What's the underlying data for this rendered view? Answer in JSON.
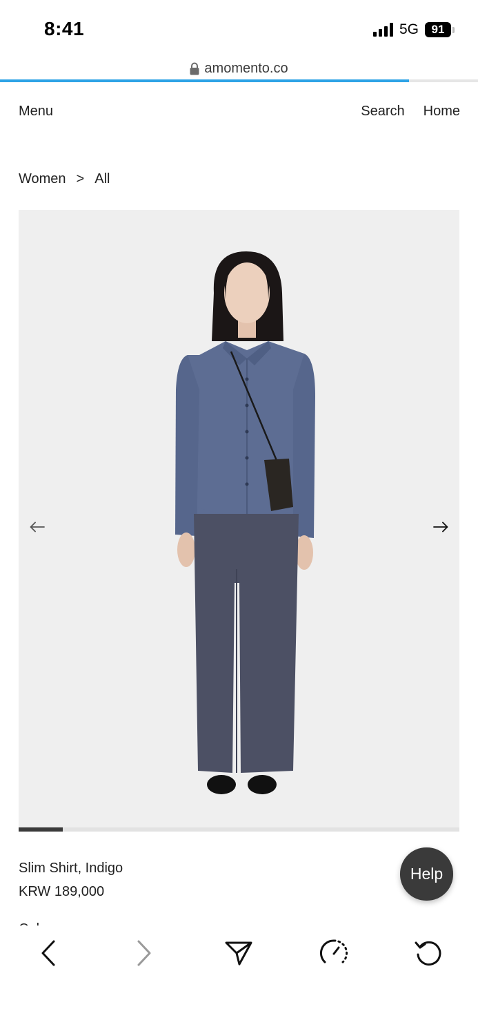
{
  "status_bar": {
    "time": "8:41",
    "network": "5G",
    "battery": "91"
  },
  "browser": {
    "url": "amomento.co",
    "load_progress": 0.856,
    "accent_color": "#2ea3e6"
  },
  "nav": {
    "menu_label": "Menu",
    "search_label": "Search",
    "home_label": "Home"
  },
  "breadcrumb": {
    "items": [
      "Women",
      ">",
      "All"
    ]
  },
  "gallery": {
    "prev_icon": "arrow-left-icon",
    "next_icon": "arrow-right-icon",
    "current_fraction": 0.1
  },
  "product": {
    "name": "Slim Shirt, Indigo",
    "price": "KRW 189,000",
    "color_label": "Color"
  },
  "help": {
    "label": "Help"
  },
  "toolbar": {
    "icons": [
      "chevron-left-icon",
      "chevron-right-icon",
      "share-icon",
      "speed-icon",
      "reload-icon"
    ]
  }
}
